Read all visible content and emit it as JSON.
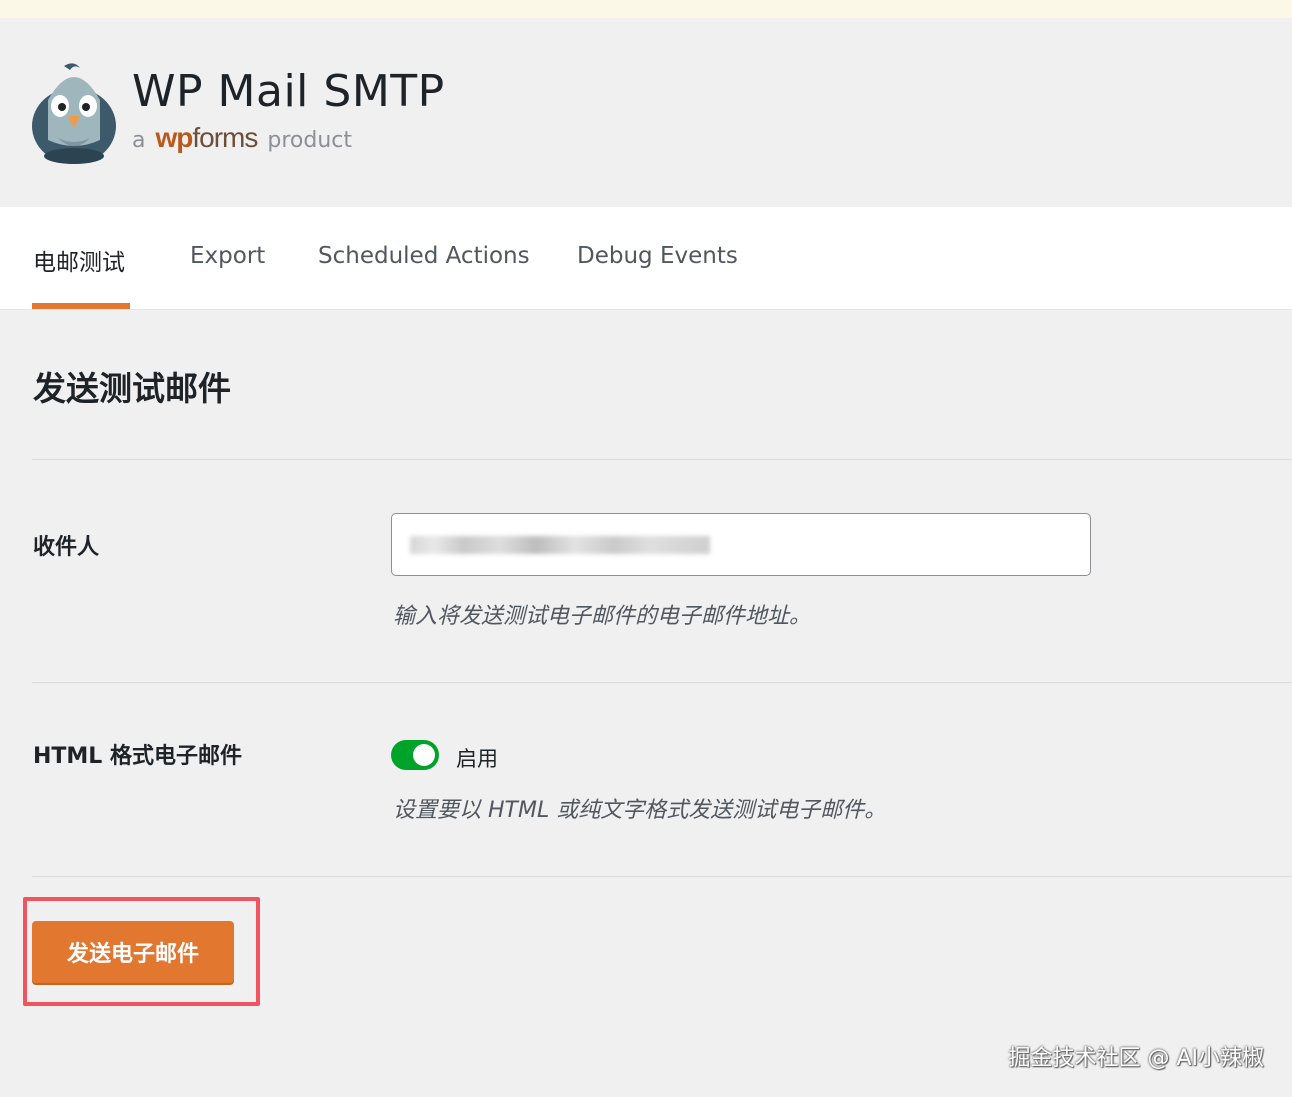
{
  "header": {
    "brand_title": "WP Mail SMTP",
    "brand_sub_a": "a",
    "brand_sub_wp": "wp",
    "brand_sub_forms": "forms",
    "brand_sub_product": "product",
    "mascot_icon": "pigeon-mascot-icon"
  },
  "tabs": [
    {
      "label": "电邮测试",
      "active": true
    },
    {
      "label": "Export",
      "active": false
    },
    {
      "label": "Scheduled Actions",
      "active": false
    },
    {
      "label": "Debug Events",
      "active": false
    }
  ],
  "main": {
    "section_title": "发送测试邮件",
    "recipient": {
      "label": "收件人",
      "value": "",
      "help": "输入将发送测试电子邮件的电子邮件地址。"
    },
    "html_format": {
      "label": "HTML 格式电子邮件",
      "toggle_on": true,
      "toggle_label": "启用",
      "help": "设置要以 HTML 或纯文字格式发送测试电子邮件。"
    },
    "send_button_label": "发送电子邮件"
  },
  "watermark": "掘金技术社区 @ AI小辣椒",
  "colors": {
    "accent": "#e27730",
    "toggle_on": "#00a32a",
    "highlight": "#f0545e",
    "background": "#f0f0f1"
  }
}
